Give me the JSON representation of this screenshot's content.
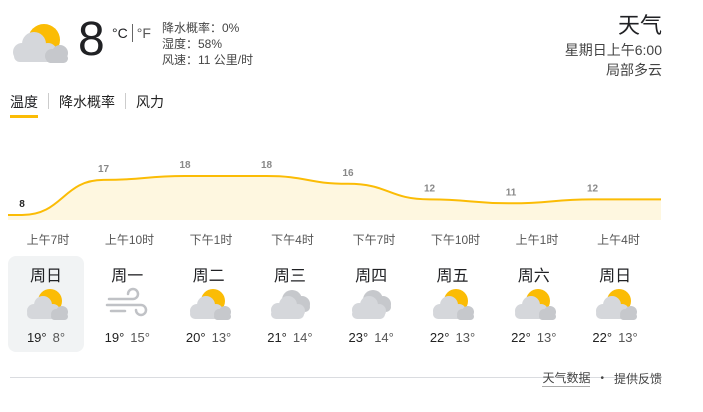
{
  "current": {
    "icon": "partly-cloudy-icon",
    "temperature": "8",
    "unit_c": "°C",
    "unit_f": "°F",
    "precipitation": "降水概率：0%",
    "humidity": "湿度：58%",
    "wind": "风速：11 公里/时"
  },
  "location": {
    "title": "天气",
    "datetime": "星期日上午6:00",
    "condition": "局部多云"
  },
  "tabs": [
    {
      "label": "温度",
      "active": true
    },
    {
      "label": "降水概率",
      "active": false
    },
    {
      "label": "风力",
      "active": false
    }
  ],
  "chart_data": {
    "type": "area",
    "x": [
      "上午7时",
      "上午10时",
      "下午1时",
      "下午4时",
      "下午7时",
      "下午10时",
      "上午1时",
      "上午4时"
    ],
    "series": [
      {
        "values": [
          8,
          17,
          18,
          18,
          16,
          12,
          11,
          12
        ]
      }
    ],
    "labels": [
      "8",
      "17",
      "18",
      "18",
      "16",
      "12",
      "11",
      "12"
    ],
    "color": "#fbbc05",
    "fill": "#fef7e0"
  },
  "hours": [
    "上午7时",
    "上午10时",
    "下午1时",
    "下午4时",
    "下午7时",
    "下午10时",
    "上午1时",
    "上午4时"
  ],
  "days": [
    {
      "name": "周日",
      "icon": "partly-cloudy-icon",
      "high": "19°",
      "low": "8°",
      "selected": true
    },
    {
      "name": "周一",
      "icon": "wind-icon",
      "high": "19°",
      "low": "15°",
      "selected": false
    },
    {
      "name": "周二",
      "icon": "partly-cloudy-icon",
      "high": "20°",
      "low": "13°",
      "selected": false
    },
    {
      "name": "周三",
      "icon": "cloudy-icon",
      "high": "21°",
      "low": "14°",
      "selected": false
    },
    {
      "name": "周四",
      "icon": "cloudy-icon",
      "high": "23°",
      "low": "14°",
      "selected": false
    },
    {
      "name": "周五",
      "icon": "partly-cloudy-icon",
      "high": "22°",
      "low": "13°",
      "selected": false
    },
    {
      "name": "周六",
      "icon": "partly-cloudy-icon",
      "high": "22°",
      "low": "13°",
      "selected": false
    },
    {
      "name": "周日",
      "icon": "partly-cloudy-icon",
      "high": "22°",
      "low": "13°",
      "selected": false
    }
  ],
  "footer": {
    "source": "天气数据",
    "feedback": "提供反馈"
  }
}
